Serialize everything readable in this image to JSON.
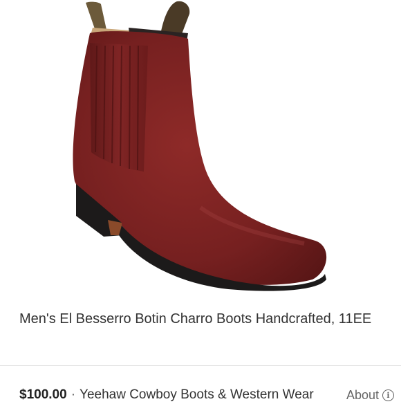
{
  "product": {
    "title": "Men's El Besserro Botin Charro Boots Handcrafted, 11EE",
    "price": "$100.00",
    "separator": "·",
    "seller": "Yeehaw Cowboy Boots & Western Wear",
    "about_label": "About",
    "about_icon": "info-icon",
    "about_glyph": "i"
  },
  "colors": {
    "leather": "#7a1f1e",
    "sole": "#1c1a1a"
  }
}
